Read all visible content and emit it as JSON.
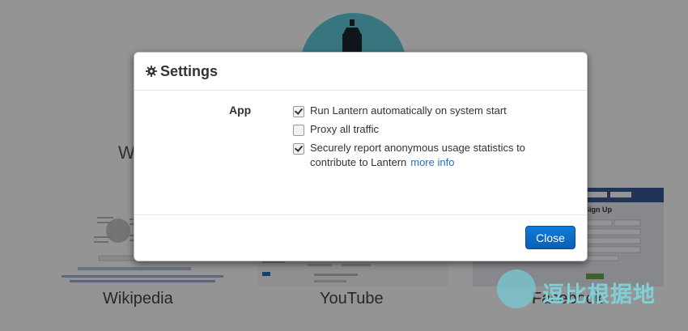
{
  "background": {
    "partial_heading": "W",
    "sites": [
      {
        "name": "Wikipedia"
      },
      {
        "name": "YouTube"
      },
      {
        "name": "Facebook"
      }
    ],
    "facebook_thumb": {
      "signup": "Sign Up"
    }
  },
  "modal": {
    "title": "Settings",
    "title_icon": "gear-icon",
    "section_label": "App",
    "options": [
      {
        "label": "Run Lantern automatically on system start",
        "checked": true
      },
      {
        "label": "Proxy all traffic",
        "checked": false
      },
      {
        "label_line1": "Securely report anonymous usage statistics to",
        "label_line2": "contribute to Lantern",
        "link": "more info",
        "checked": true
      }
    ],
    "close_label": "Close"
  },
  "colors": {
    "accent_teal": "#5fcbd9",
    "primary_button": "#0a66c2",
    "link": "#2a6ebb"
  },
  "watermark": {
    "text": "逗比根据地"
  }
}
